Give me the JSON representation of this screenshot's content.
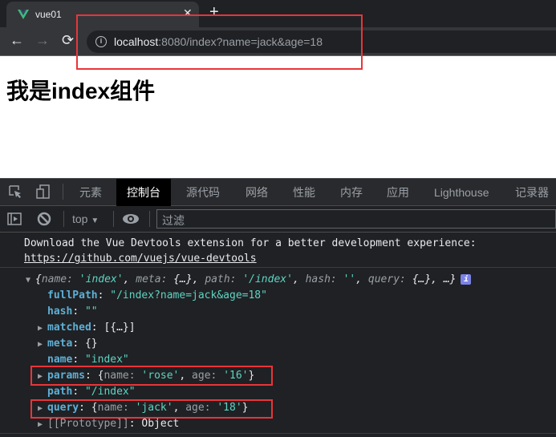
{
  "browser": {
    "tab_title": "vue01",
    "url_host": "localhost",
    "url_rest": ":8080/index?name=jack&age=18"
  },
  "page": {
    "heading": "我是index组件"
  },
  "devtools": {
    "tabs": [
      "元素",
      "控制台",
      "源代码",
      "网络",
      "性能",
      "内存",
      "应用",
      "Lighthouse",
      "记录器"
    ],
    "active_tab": "控制台",
    "context": "top",
    "filter_placeholder": "过滤"
  },
  "console": {
    "message_line1": "Download the Vue Devtools extension for a better development experience:",
    "message_link": "https://github.com/vuejs/vue-devtools",
    "summary": {
      "open": "{",
      "k1": "name",
      "v1": "'index'",
      "k2": "meta",
      "v2": "{…}",
      "k3": "path",
      "v3": "'/index'",
      "k4": "hash",
      "v4": "''",
      "k5": "query",
      "v5": "{…}",
      "tail": ", …}"
    },
    "props": {
      "fullPath_key": "fullPath",
      "fullPath_val": "\"/index?name=jack&age=18\"",
      "hash_key": "hash",
      "hash_val": "\"\"",
      "matched_key": "matched",
      "matched_val": "[{…}]",
      "meta_key": "meta",
      "meta_val": "{}",
      "name_key": "name",
      "name_val": "\"index\"",
      "params_key": "params",
      "params_name": "'rose'",
      "params_age": "'16'",
      "path_key": "path",
      "path_val": "\"/index\"",
      "query_key": "query",
      "query_name": "'jack'",
      "query_age": "'18'",
      "proto_key": "[[Prototype]]",
      "proto_val": "Object",
      "name_label": "name",
      "age_label": "age"
    }
  }
}
